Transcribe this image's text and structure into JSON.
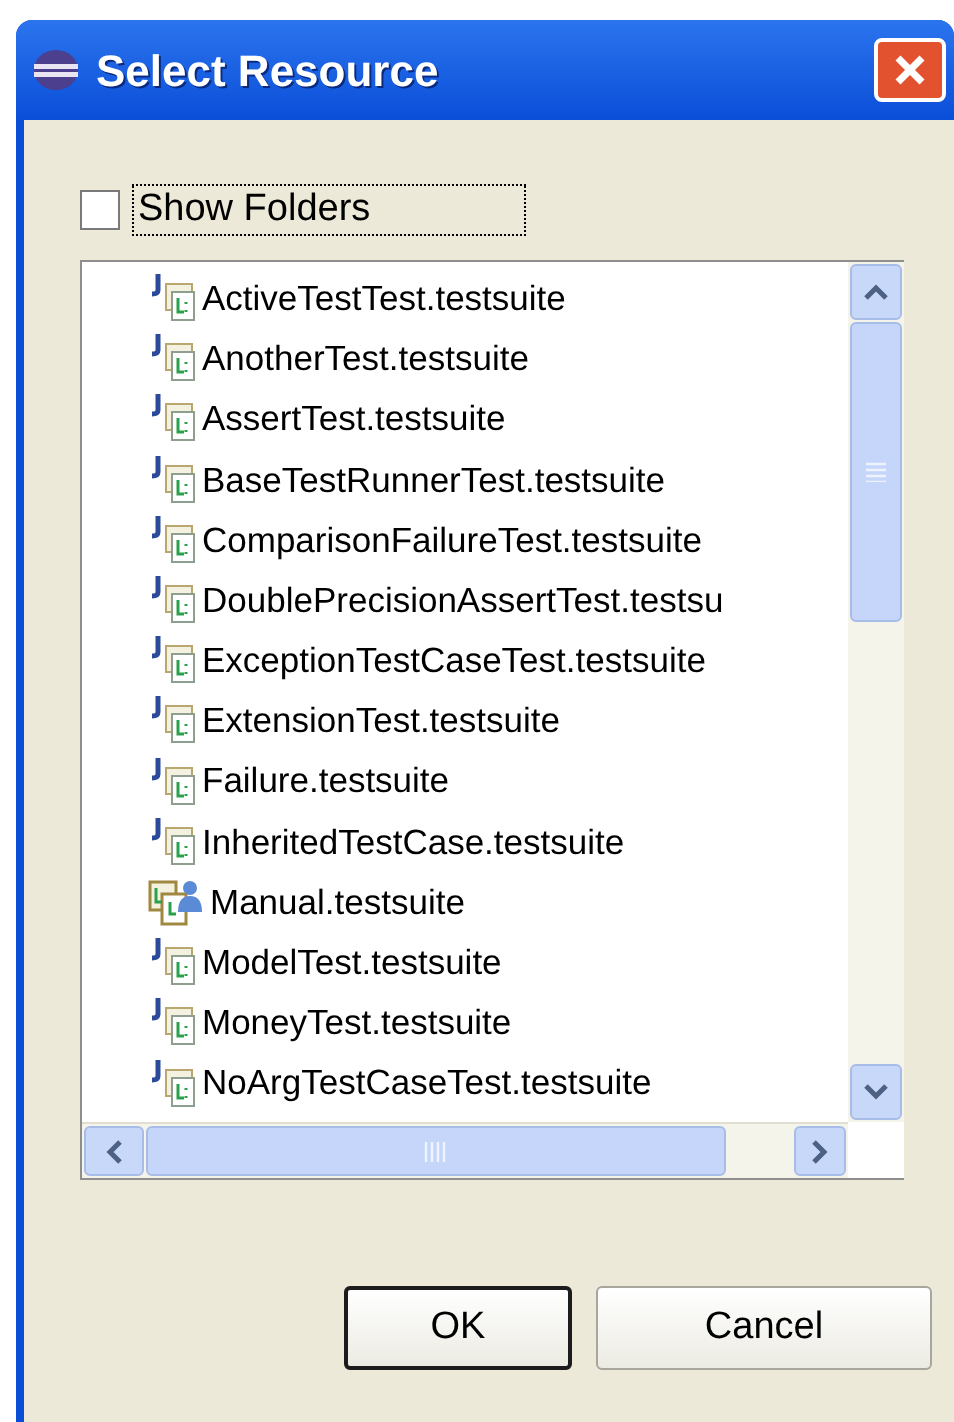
{
  "window": {
    "title": "Select Resource"
  },
  "show_folders": {
    "label": "Show Folders",
    "checked": false
  },
  "files": [
    {
      "name": "ActiveTestTest.testsuite",
      "kind": "junit"
    },
    {
      "name": "AnotherTest.testsuite",
      "kind": "junit"
    },
    {
      "name": "AssertTest.testsuite",
      "kind": "junit"
    },
    {
      "name": "BaseTestRunnerTest.testsuite",
      "kind": "junit"
    },
    {
      "name": "ComparisonFailureTest.testsuite",
      "kind": "junit"
    },
    {
      "name": "DoublePrecisionAssertTest.testsu",
      "kind": "junit"
    },
    {
      "name": "ExceptionTestCaseTest.testsuite",
      "kind": "junit"
    },
    {
      "name": "ExtensionTest.testsuite",
      "kind": "junit"
    },
    {
      "name": "Failure.testsuite",
      "kind": "junit"
    },
    {
      "name": "InheritedTestCase.testsuite",
      "kind": "junit"
    },
    {
      "name": "Manual.testsuite",
      "kind": "manual"
    },
    {
      "name": "ModelTest.testsuite",
      "kind": "junit"
    },
    {
      "name": "MoneyTest.testsuite",
      "kind": "junit"
    },
    {
      "name": "NoArgTestCaseTest.testsuite",
      "kind": "junit"
    }
  ],
  "buttons": [
    {
      "label": "OK",
      "default": true
    },
    {
      "label": "Cancel",
      "default": false
    }
  ]
}
